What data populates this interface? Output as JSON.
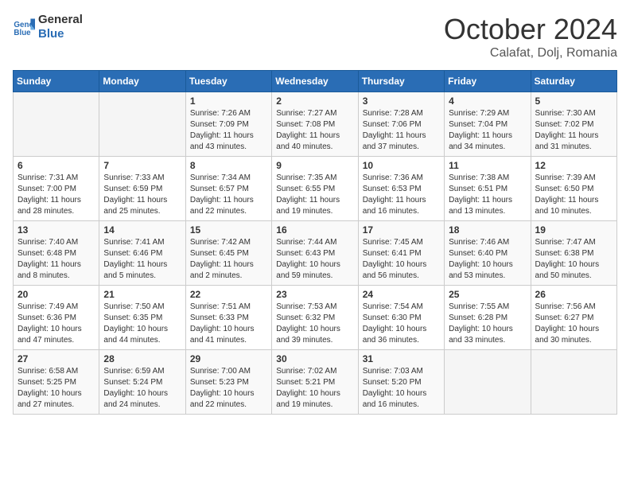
{
  "logo": {
    "line1": "General",
    "line2": "Blue"
  },
  "title": "October 2024",
  "subtitle": "Calafat, Dolj, Romania",
  "days_of_week": [
    "Sunday",
    "Monday",
    "Tuesday",
    "Wednesday",
    "Thursday",
    "Friday",
    "Saturday"
  ],
  "weeks": [
    [
      {
        "day": "",
        "info": ""
      },
      {
        "day": "",
        "info": ""
      },
      {
        "day": "1",
        "info": "Sunrise: 7:26 AM\nSunset: 7:09 PM\nDaylight: 11 hours and 43 minutes."
      },
      {
        "day": "2",
        "info": "Sunrise: 7:27 AM\nSunset: 7:08 PM\nDaylight: 11 hours and 40 minutes."
      },
      {
        "day": "3",
        "info": "Sunrise: 7:28 AM\nSunset: 7:06 PM\nDaylight: 11 hours and 37 minutes."
      },
      {
        "day": "4",
        "info": "Sunrise: 7:29 AM\nSunset: 7:04 PM\nDaylight: 11 hours and 34 minutes."
      },
      {
        "day": "5",
        "info": "Sunrise: 7:30 AM\nSunset: 7:02 PM\nDaylight: 11 hours and 31 minutes."
      }
    ],
    [
      {
        "day": "6",
        "info": "Sunrise: 7:31 AM\nSunset: 7:00 PM\nDaylight: 11 hours and 28 minutes."
      },
      {
        "day": "7",
        "info": "Sunrise: 7:33 AM\nSunset: 6:59 PM\nDaylight: 11 hours and 25 minutes."
      },
      {
        "day": "8",
        "info": "Sunrise: 7:34 AM\nSunset: 6:57 PM\nDaylight: 11 hours and 22 minutes."
      },
      {
        "day": "9",
        "info": "Sunrise: 7:35 AM\nSunset: 6:55 PM\nDaylight: 11 hours and 19 minutes."
      },
      {
        "day": "10",
        "info": "Sunrise: 7:36 AM\nSunset: 6:53 PM\nDaylight: 11 hours and 16 minutes."
      },
      {
        "day": "11",
        "info": "Sunrise: 7:38 AM\nSunset: 6:51 PM\nDaylight: 11 hours and 13 minutes."
      },
      {
        "day": "12",
        "info": "Sunrise: 7:39 AM\nSunset: 6:50 PM\nDaylight: 11 hours and 10 minutes."
      }
    ],
    [
      {
        "day": "13",
        "info": "Sunrise: 7:40 AM\nSunset: 6:48 PM\nDaylight: 11 hours and 8 minutes."
      },
      {
        "day": "14",
        "info": "Sunrise: 7:41 AM\nSunset: 6:46 PM\nDaylight: 11 hours and 5 minutes."
      },
      {
        "day": "15",
        "info": "Sunrise: 7:42 AM\nSunset: 6:45 PM\nDaylight: 11 hours and 2 minutes."
      },
      {
        "day": "16",
        "info": "Sunrise: 7:44 AM\nSunset: 6:43 PM\nDaylight: 10 hours and 59 minutes."
      },
      {
        "day": "17",
        "info": "Sunrise: 7:45 AM\nSunset: 6:41 PM\nDaylight: 10 hours and 56 minutes."
      },
      {
        "day": "18",
        "info": "Sunrise: 7:46 AM\nSunset: 6:40 PM\nDaylight: 10 hours and 53 minutes."
      },
      {
        "day": "19",
        "info": "Sunrise: 7:47 AM\nSunset: 6:38 PM\nDaylight: 10 hours and 50 minutes."
      }
    ],
    [
      {
        "day": "20",
        "info": "Sunrise: 7:49 AM\nSunset: 6:36 PM\nDaylight: 10 hours and 47 minutes."
      },
      {
        "day": "21",
        "info": "Sunrise: 7:50 AM\nSunset: 6:35 PM\nDaylight: 10 hours and 44 minutes."
      },
      {
        "day": "22",
        "info": "Sunrise: 7:51 AM\nSunset: 6:33 PM\nDaylight: 10 hours and 41 minutes."
      },
      {
        "day": "23",
        "info": "Sunrise: 7:53 AM\nSunset: 6:32 PM\nDaylight: 10 hours and 39 minutes."
      },
      {
        "day": "24",
        "info": "Sunrise: 7:54 AM\nSunset: 6:30 PM\nDaylight: 10 hours and 36 minutes."
      },
      {
        "day": "25",
        "info": "Sunrise: 7:55 AM\nSunset: 6:28 PM\nDaylight: 10 hours and 33 minutes."
      },
      {
        "day": "26",
        "info": "Sunrise: 7:56 AM\nSunset: 6:27 PM\nDaylight: 10 hours and 30 minutes."
      }
    ],
    [
      {
        "day": "27",
        "info": "Sunrise: 6:58 AM\nSunset: 5:25 PM\nDaylight: 10 hours and 27 minutes."
      },
      {
        "day": "28",
        "info": "Sunrise: 6:59 AM\nSunset: 5:24 PM\nDaylight: 10 hours and 24 minutes."
      },
      {
        "day": "29",
        "info": "Sunrise: 7:00 AM\nSunset: 5:23 PM\nDaylight: 10 hours and 22 minutes."
      },
      {
        "day": "30",
        "info": "Sunrise: 7:02 AM\nSunset: 5:21 PM\nDaylight: 10 hours and 19 minutes."
      },
      {
        "day": "31",
        "info": "Sunrise: 7:03 AM\nSunset: 5:20 PM\nDaylight: 10 hours and 16 minutes."
      },
      {
        "day": "",
        "info": ""
      },
      {
        "day": "",
        "info": ""
      }
    ]
  ]
}
